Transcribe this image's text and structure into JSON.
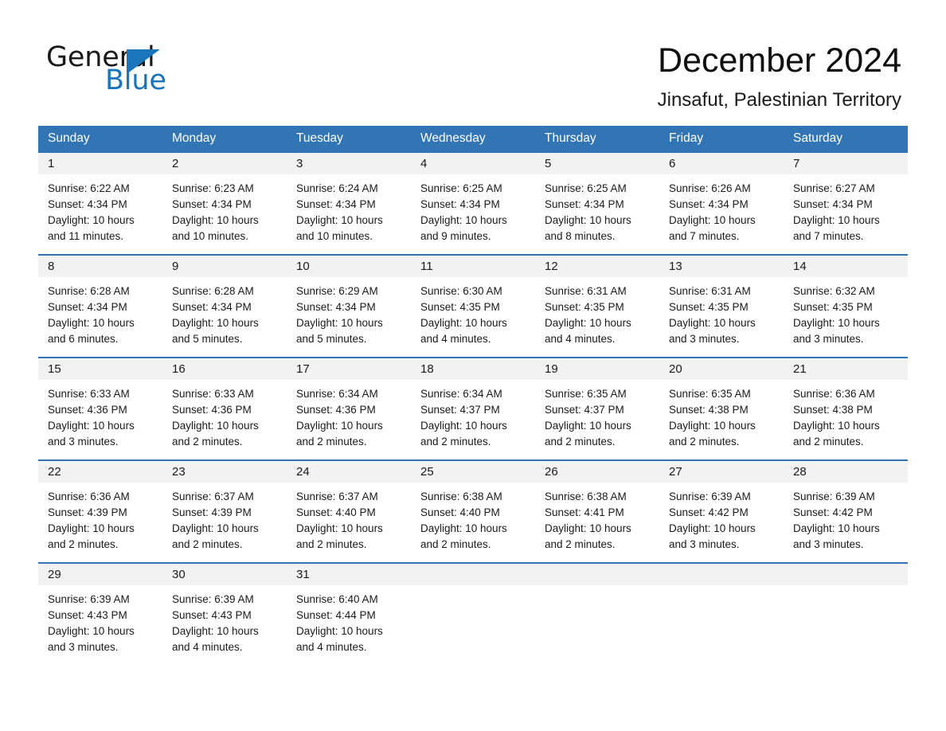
{
  "brand": {
    "word_one": "General",
    "word_two": "Blue",
    "logo_icon": "triangle-logo-icon"
  },
  "header": {
    "title": "December 2024",
    "subtitle": "Jinsafut, Palestinian Territory"
  },
  "colors": {
    "header_blue": "#3275b5",
    "brand_blue": "#1b75bb",
    "day_band": "#f2f2f2",
    "text": "#1a1a1a"
  },
  "calendar": {
    "weekdays": [
      "Sunday",
      "Monday",
      "Tuesday",
      "Wednesday",
      "Thursday",
      "Friday",
      "Saturday"
    ],
    "weeks": [
      [
        {
          "day": "1",
          "sunrise": "Sunrise: 6:22 AM",
          "sunset": "Sunset: 4:34 PM",
          "daylight_1": "Daylight: 10 hours",
          "daylight_2": "and 11 minutes."
        },
        {
          "day": "2",
          "sunrise": "Sunrise: 6:23 AM",
          "sunset": "Sunset: 4:34 PM",
          "daylight_1": "Daylight: 10 hours",
          "daylight_2": "and 10 minutes."
        },
        {
          "day": "3",
          "sunrise": "Sunrise: 6:24 AM",
          "sunset": "Sunset: 4:34 PM",
          "daylight_1": "Daylight: 10 hours",
          "daylight_2": "and 10 minutes."
        },
        {
          "day": "4",
          "sunrise": "Sunrise: 6:25 AM",
          "sunset": "Sunset: 4:34 PM",
          "daylight_1": "Daylight: 10 hours",
          "daylight_2": "and 9 minutes."
        },
        {
          "day": "5",
          "sunrise": "Sunrise: 6:25 AM",
          "sunset": "Sunset: 4:34 PM",
          "daylight_1": "Daylight: 10 hours",
          "daylight_2": "and 8 minutes."
        },
        {
          "day": "6",
          "sunrise": "Sunrise: 6:26 AM",
          "sunset": "Sunset: 4:34 PM",
          "daylight_1": "Daylight: 10 hours",
          "daylight_2": "and 7 minutes."
        },
        {
          "day": "7",
          "sunrise": "Sunrise: 6:27 AM",
          "sunset": "Sunset: 4:34 PM",
          "daylight_1": "Daylight: 10 hours",
          "daylight_2": "and 7 minutes."
        }
      ],
      [
        {
          "day": "8",
          "sunrise": "Sunrise: 6:28 AM",
          "sunset": "Sunset: 4:34 PM",
          "daylight_1": "Daylight: 10 hours",
          "daylight_2": "and 6 minutes."
        },
        {
          "day": "9",
          "sunrise": "Sunrise: 6:28 AM",
          "sunset": "Sunset: 4:34 PM",
          "daylight_1": "Daylight: 10 hours",
          "daylight_2": "and 5 minutes."
        },
        {
          "day": "10",
          "sunrise": "Sunrise: 6:29 AM",
          "sunset": "Sunset: 4:34 PM",
          "daylight_1": "Daylight: 10 hours",
          "daylight_2": "and 5 minutes."
        },
        {
          "day": "11",
          "sunrise": "Sunrise: 6:30 AM",
          "sunset": "Sunset: 4:35 PM",
          "daylight_1": "Daylight: 10 hours",
          "daylight_2": "and 4 minutes."
        },
        {
          "day": "12",
          "sunrise": "Sunrise: 6:31 AM",
          "sunset": "Sunset: 4:35 PM",
          "daylight_1": "Daylight: 10 hours",
          "daylight_2": "and 4 minutes."
        },
        {
          "day": "13",
          "sunrise": "Sunrise: 6:31 AM",
          "sunset": "Sunset: 4:35 PM",
          "daylight_1": "Daylight: 10 hours",
          "daylight_2": "and 3 minutes."
        },
        {
          "day": "14",
          "sunrise": "Sunrise: 6:32 AM",
          "sunset": "Sunset: 4:35 PM",
          "daylight_1": "Daylight: 10 hours",
          "daylight_2": "and 3 minutes."
        }
      ],
      [
        {
          "day": "15",
          "sunrise": "Sunrise: 6:33 AM",
          "sunset": "Sunset: 4:36 PM",
          "daylight_1": "Daylight: 10 hours",
          "daylight_2": "and 3 minutes."
        },
        {
          "day": "16",
          "sunrise": "Sunrise: 6:33 AM",
          "sunset": "Sunset: 4:36 PM",
          "daylight_1": "Daylight: 10 hours",
          "daylight_2": "and 2 minutes."
        },
        {
          "day": "17",
          "sunrise": "Sunrise: 6:34 AM",
          "sunset": "Sunset: 4:36 PM",
          "daylight_1": "Daylight: 10 hours",
          "daylight_2": "and 2 minutes."
        },
        {
          "day": "18",
          "sunrise": "Sunrise: 6:34 AM",
          "sunset": "Sunset: 4:37 PM",
          "daylight_1": "Daylight: 10 hours",
          "daylight_2": "and 2 minutes."
        },
        {
          "day": "19",
          "sunrise": "Sunrise: 6:35 AM",
          "sunset": "Sunset: 4:37 PM",
          "daylight_1": "Daylight: 10 hours",
          "daylight_2": "and 2 minutes."
        },
        {
          "day": "20",
          "sunrise": "Sunrise: 6:35 AM",
          "sunset": "Sunset: 4:38 PM",
          "daylight_1": "Daylight: 10 hours",
          "daylight_2": "and 2 minutes."
        },
        {
          "day": "21",
          "sunrise": "Sunrise: 6:36 AM",
          "sunset": "Sunset: 4:38 PM",
          "daylight_1": "Daylight: 10 hours",
          "daylight_2": "and 2 minutes."
        }
      ],
      [
        {
          "day": "22",
          "sunrise": "Sunrise: 6:36 AM",
          "sunset": "Sunset: 4:39 PM",
          "daylight_1": "Daylight: 10 hours",
          "daylight_2": "and 2 minutes."
        },
        {
          "day": "23",
          "sunrise": "Sunrise: 6:37 AM",
          "sunset": "Sunset: 4:39 PM",
          "daylight_1": "Daylight: 10 hours",
          "daylight_2": "and 2 minutes."
        },
        {
          "day": "24",
          "sunrise": "Sunrise: 6:37 AM",
          "sunset": "Sunset: 4:40 PM",
          "daylight_1": "Daylight: 10 hours",
          "daylight_2": "and 2 minutes."
        },
        {
          "day": "25",
          "sunrise": "Sunrise: 6:38 AM",
          "sunset": "Sunset: 4:40 PM",
          "daylight_1": "Daylight: 10 hours",
          "daylight_2": "and 2 minutes."
        },
        {
          "day": "26",
          "sunrise": "Sunrise: 6:38 AM",
          "sunset": "Sunset: 4:41 PM",
          "daylight_1": "Daylight: 10 hours",
          "daylight_2": "and 2 minutes."
        },
        {
          "day": "27",
          "sunrise": "Sunrise: 6:39 AM",
          "sunset": "Sunset: 4:42 PM",
          "daylight_1": "Daylight: 10 hours",
          "daylight_2": "and 3 minutes."
        },
        {
          "day": "28",
          "sunrise": "Sunrise: 6:39 AM",
          "sunset": "Sunset: 4:42 PM",
          "daylight_1": "Daylight: 10 hours",
          "daylight_2": "and 3 minutes."
        }
      ],
      [
        {
          "day": "29",
          "sunrise": "Sunrise: 6:39 AM",
          "sunset": "Sunset: 4:43 PM",
          "daylight_1": "Daylight: 10 hours",
          "daylight_2": "and 3 minutes."
        },
        {
          "day": "30",
          "sunrise": "Sunrise: 6:39 AM",
          "sunset": "Sunset: 4:43 PM",
          "daylight_1": "Daylight: 10 hours",
          "daylight_2": "and 4 minutes."
        },
        {
          "day": "31",
          "sunrise": "Sunrise: 6:40 AM",
          "sunset": "Sunset: 4:44 PM",
          "daylight_1": "Daylight: 10 hours",
          "daylight_2": "and 4 minutes."
        },
        {
          "day": "",
          "sunrise": "",
          "sunset": "",
          "daylight_1": "",
          "daylight_2": ""
        },
        {
          "day": "",
          "sunrise": "",
          "sunset": "",
          "daylight_1": "",
          "daylight_2": ""
        },
        {
          "day": "",
          "sunrise": "",
          "sunset": "",
          "daylight_1": "",
          "daylight_2": ""
        },
        {
          "day": "",
          "sunrise": "",
          "sunset": "",
          "daylight_1": "",
          "daylight_2": ""
        }
      ]
    ]
  }
}
